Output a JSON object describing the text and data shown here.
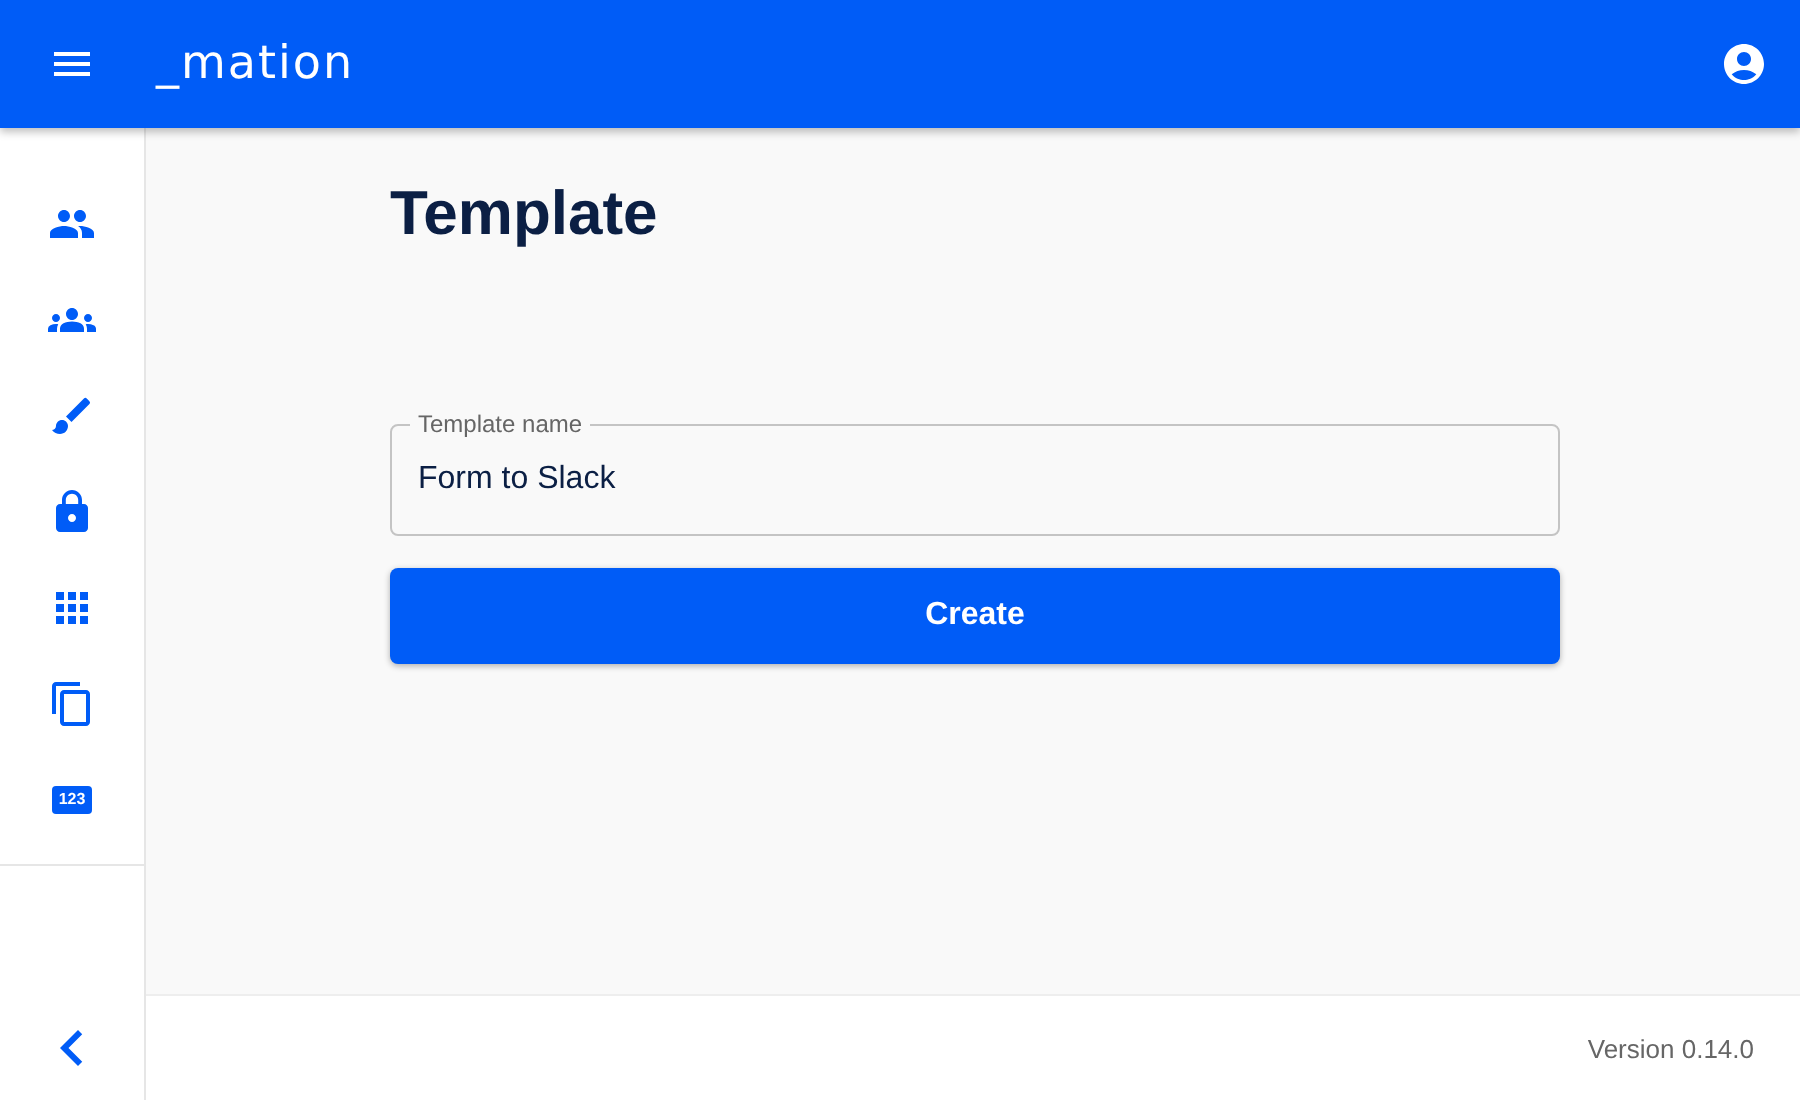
{
  "app_bar": {
    "logo": "_mation"
  },
  "sidebar": {
    "items": [
      {
        "kind": "icon"
      },
      {
        "kind": "icon"
      },
      {
        "kind": "icon"
      },
      {
        "kind": "icon"
      },
      {
        "kind": "icon"
      },
      {
        "kind": "icon"
      },
      {
        "kind": "badge",
        "text": "123"
      }
    ]
  },
  "page": {
    "title": "Template",
    "field": {
      "label": "Template name",
      "value": "Form to Slack"
    },
    "button": "Create"
  },
  "footer": {
    "version": "Version 0.14.0"
  }
}
